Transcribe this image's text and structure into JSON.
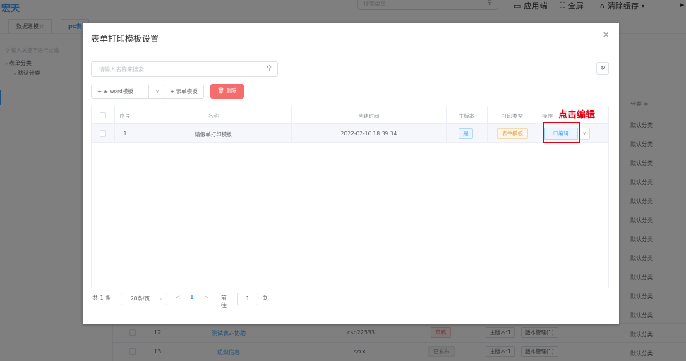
{
  "app": {
    "brand": "宏天",
    "search_placeholder": "搜索菜单",
    "actions": [
      {
        "label": "应用端",
        "icon": "monitor-icon"
      },
      {
        "label": "全屏",
        "icon": "fullscreen-icon"
      },
      {
        "label": "清除缓存",
        "icon": "clear-cache-icon"
      }
    ]
  },
  "tabs": [
    {
      "label": "数据建模☆"
    },
    {
      "label": "pc表"
    }
  ],
  "sidebar": {
    "filter_placeholder": "输入关键字进行过滤",
    "tree": [
      {
        "label": "表单分类",
        "level": 0
      },
      {
        "label": "默认分类",
        "level": 1
      }
    ]
  },
  "bg_table": {
    "category_header": "分类 ≑",
    "category_cells": [
      "默认分类",
      "默认分类",
      "默认分类",
      "默认分类",
      "默认分类",
      "默认分类",
      "默认分类",
      "默认分类",
      "默认分类",
      "默认分类",
      "默认分类",
      "默认分类"
    ],
    "rows": [
      {
        "no": "12",
        "name": "测试表2-协助",
        "code": "csb22533",
        "status": "草稿",
        "status_color": "#f56c6c",
        "version": "主版本:1",
        "manage": "版本管理(1)"
      },
      {
        "no": "13",
        "name": "组织信息",
        "code": "zzxx",
        "status": "已发布",
        "status_color": "#909399",
        "version": "主版本:1",
        "manage": "版本管理(1)"
      }
    ]
  },
  "dialog": {
    "title": "表单打印模板设置",
    "search_placeholder": "请输入名称来搜索",
    "toolbar": {
      "word_template": "+ ⊕ word模板",
      "word_dropdown": "∨",
      "form_template": "+ 表单模板",
      "delete": "🗑 删除"
    },
    "table": {
      "headers": {
        "index": "序号",
        "name": "名称",
        "created": "创建时间",
        "main_version": "主版本",
        "print_type": "打印类型",
        "operation": "操作"
      },
      "rows": [
        {
          "index": "1",
          "name": "请假单打印模板",
          "created": "2022-02-16 18:39:34",
          "main_version": "是",
          "print_type": "表单模板",
          "edit": "☐编辑",
          "more": "∨"
        }
      ]
    },
    "annotation": "点击编辑",
    "pager": {
      "total": "共 1 条",
      "page_size": "20条/页",
      "prev": "<",
      "current": "1",
      "next": ">",
      "goto_label": "前往",
      "goto_value": "1",
      "goto_unit": "页"
    }
  },
  "colors": {
    "primary": "#409eff",
    "danger": "#f56c6c",
    "annotation": "#e60012",
    "warning_bg": "#fdf6ec",
    "warning_text": "#e6a23c"
  }
}
